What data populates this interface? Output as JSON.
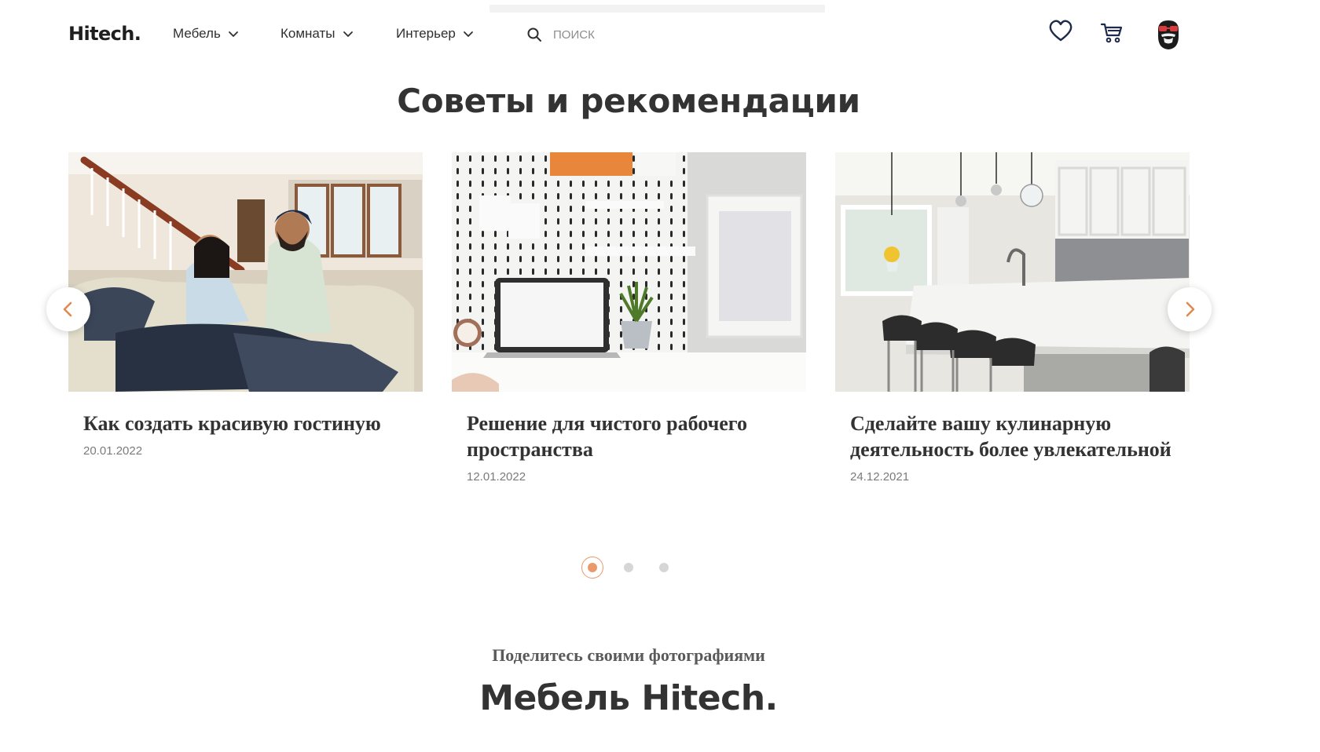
{
  "header": {
    "logo": "Hitech.",
    "nav": [
      {
        "label": "Мебель"
      },
      {
        "label": "Комнаты"
      },
      {
        "label": "Интерьер"
      }
    ],
    "search": {
      "placeholder": "ПОИСК"
    }
  },
  "tips": {
    "title": "Советы и рекомендации",
    "cards": [
      {
        "title": "Как создать красивую гостиную",
        "date": "20.01.2022"
      },
      {
        "title": "Решение для чистого рабочего пространства",
        "date": "12.01.2022"
      },
      {
        "title": "Сделайте вашу кулинарную деятельность более увлекательной",
        "date": "24.12.2021"
      }
    ],
    "pagination": {
      "count": 3,
      "active": 1
    }
  },
  "share": {
    "subtitle": "Поделитесь своими фотографиями",
    "title": "Мебель Hitech."
  },
  "colors": {
    "accent": "#e89a6c",
    "text": "#333333",
    "muted": "#7b7b7b"
  },
  "icons": [
    "chevron-down-icon",
    "search-icon",
    "heart-icon",
    "cart-icon",
    "avatar",
    "chevron-left-icon",
    "chevron-right-icon"
  ]
}
